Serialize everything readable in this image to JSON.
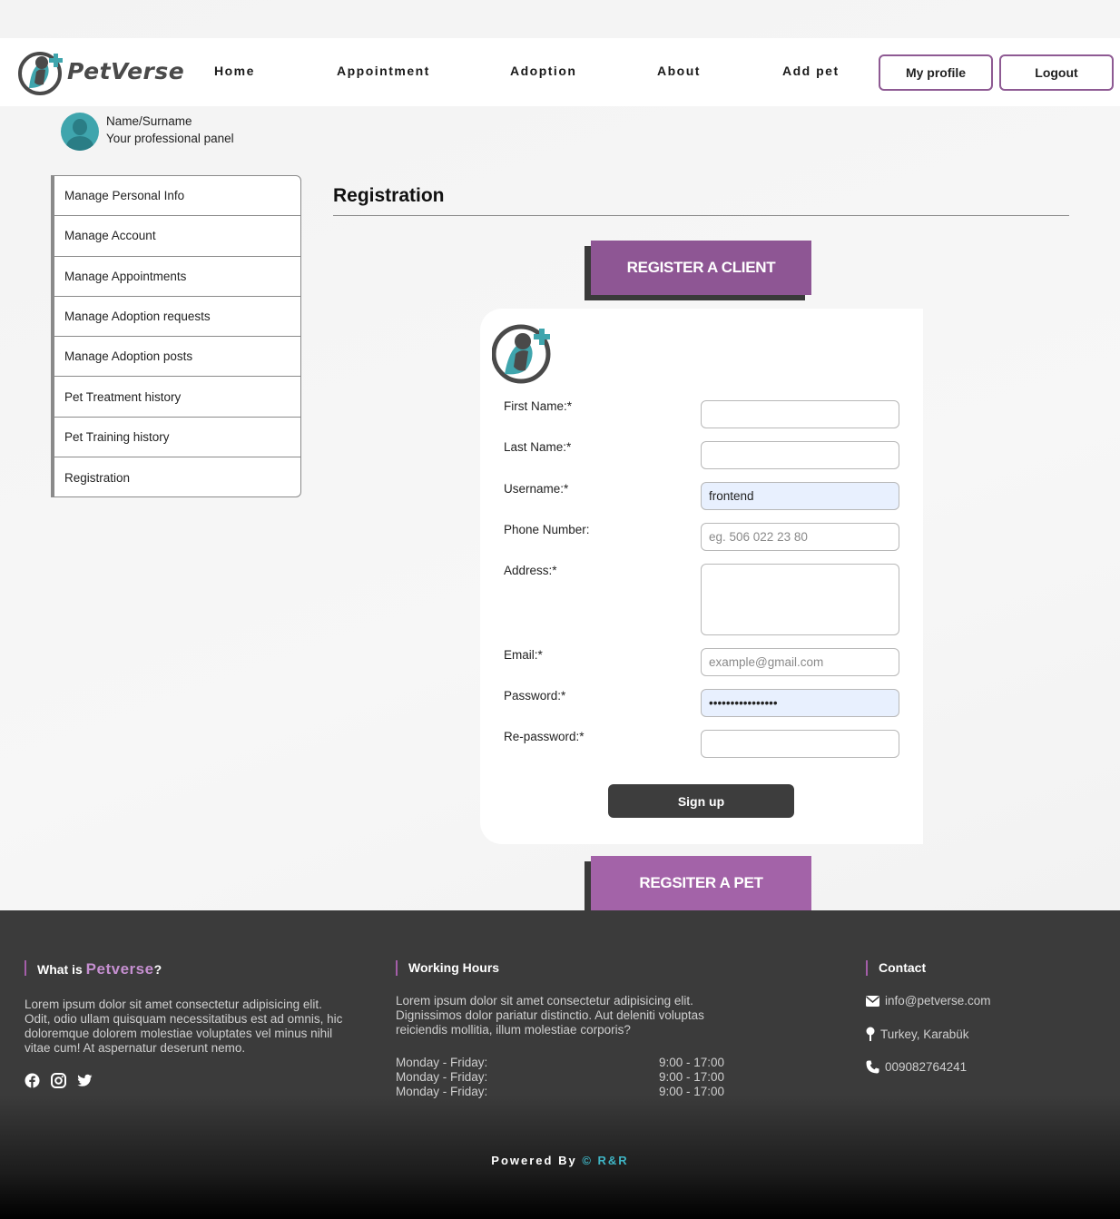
{
  "header": {
    "logo_text": "PetVerse",
    "nav": [
      "Home",
      "Appointment",
      "Adoption",
      "About",
      "Add pet"
    ],
    "my_profile": "My profile",
    "logout": "Logout"
  },
  "profile": {
    "name": "Name/Surname",
    "subtitle": "Your professional panel"
  },
  "sidebar": {
    "items": [
      "Manage Personal Info",
      "Manage Account",
      "Manage Appointments",
      "Manage Adoption requests",
      "Manage Adoption posts",
      "Pet Treatment history",
      "Pet Training history",
      "Registration"
    ],
    "active": "Registration"
  },
  "main": {
    "title": "Registration",
    "register_client": "REGISTER A CLIENT",
    "register_pet": "REGSITER A PET"
  },
  "form": {
    "first_name_label": "First Name:*",
    "last_name_label": "Last Name:*",
    "username_label": "Username:*",
    "username_value": "frontend",
    "phone_label": "Phone Number:",
    "phone_placeholder": "eg. 506 022 23 80",
    "address_label": "Address:*",
    "email_label": "Email:*",
    "email_placeholder": "example@gmail.com",
    "password_label": "Password:*",
    "password_value": "••••••••••••••••",
    "repassword_label": "Re-password:*",
    "signup": "Sign up"
  },
  "footer": {
    "what_is_prefix": "What is ",
    "what_is_brand": "Petverse",
    "what_is_suffix": "?",
    "about_text": "Lorem ipsum dolor sit amet consectetur adipisicing elit. Odit, odio ullam quisquam necessitatibus est ad omnis, hic doloremque dolorem molestiae voluptates vel minus nihil vitae cum! At aspernatur deserunt nemo.",
    "hours_title": "Working Hours",
    "hours_text": "Lorem ipsum dolor sit amet consectetur adipisicing elit. Dignissimos dolor pariatur distinctio. Aut deleniti voluptas reiciendis mollitia, illum molestiae corporis?",
    "hours": [
      {
        "days": "Monday - Friday:",
        "time": "9:00 - 17:00"
      },
      {
        "days": "Monday - Friday:",
        "time": "9:00 - 17:00"
      },
      {
        "days": "Monday - Friday:",
        "time": "9:00 - 17:00"
      }
    ],
    "contact_title": "Contact",
    "email": "info@petverse.com",
    "location": "Turkey, Karabük",
    "phone": "009082764241",
    "powered_prefix": "Powered By ",
    "powered_brand": "© R&R"
  },
  "colors": {
    "accent": "#a45ea9",
    "header_btn_border": "#8e5a93",
    "teal": "#3fa5ad",
    "dark": "#3d3d3d"
  },
  "icons": [
    "petverse-logo-icon",
    "avatar-icon",
    "facebook-icon",
    "instagram-icon",
    "twitter-icon",
    "envelope-icon",
    "map-pin-icon",
    "phone-icon"
  ]
}
